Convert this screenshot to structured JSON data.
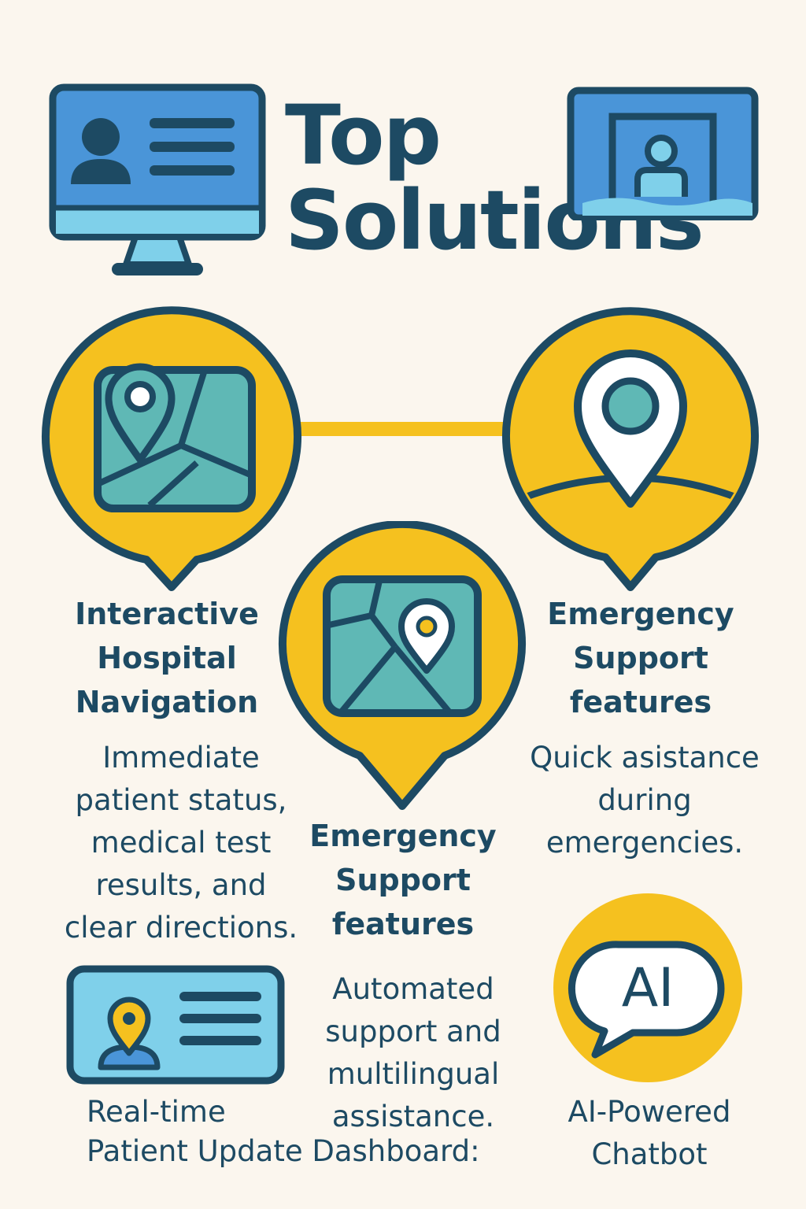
{
  "page": {
    "title_line1": "Top",
    "title_line2": "Solutions"
  },
  "features": {
    "navigation": {
      "heading": [
        "Interactive",
        "Hospital",
        "Navigation"
      ],
      "description": [
        "Immediate",
        "patient status,",
        "medical test",
        "results, and",
        "clear directions."
      ]
    },
    "emergency_right": {
      "heading": [
        "Emergency",
        "Support",
        "features"
      ],
      "description": [
        "Quick asistance",
        "during",
        "emergencies."
      ]
    },
    "emergency_center": {
      "heading": [
        "Emergency",
        "Support",
        "features"
      ],
      "description": [
        "Automated",
        "support and",
        "multilingual",
        "assistance."
      ]
    },
    "dashboard": {
      "label_line1": "Real-time",
      "label_line2": "Patient Update Dashboard:"
    },
    "chatbot": {
      "icon_text": "AI",
      "label": [
        "AI-Powered",
        "Chatbot"
      ]
    }
  },
  "icons": [
    "desktop-profile-icon",
    "video-call-icon",
    "map-pin-icon",
    "location-pin-icon",
    "map-icon",
    "patient-card-icon",
    "ai-chat-icon"
  ],
  "colors": {
    "navy": "#1d4a63",
    "yellow": "#f5c11f",
    "teal": "#5fb8b5",
    "blue": "#4a95d8",
    "light_blue": "#7fd0ea",
    "background": "#fbf6ee"
  }
}
